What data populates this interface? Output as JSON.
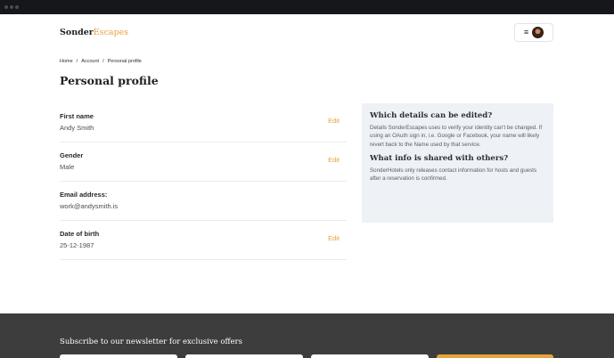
{
  "brand": {
    "name_part1": "Sonder",
    "name_part2": "Escapes"
  },
  "header": {
    "menu_icon": "hamburger-icon",
    "avatar_icon": "user-avatar"
  },
  "breadcrumb": [
    "Home",
    "Account",
    "Personal profile"
  ],
  "page": {
    "title": "Personal profile"
  },
  "fields": [
    {
      "label": "First name",
      "value": "Andy Smith",
      "edit": "Edit"
    },
    {
      "label": "Gender",
      "value": "Male",
      "edit": "Edit"
    },
    {
      "label": "Email address:",
      "value": "work@andysmith.is"
    },
    {
      "label": "Date of birth",
      "value": "25-12-1987",
      "edit": "Edit"
    }
  ],
  "info": {
    "heading1": "Which details can be edited?",
    "text1": "Details SonderEscapes uses to verify your identity can't be changed. If using an OAuth sign in, i.e. Google or Facebook, your name will likely revert back to the Name used by that service.",
    "heading2": "What info is shared with others?",
    "text2": "SonderHotels only releases contact information for hosts and guests after a reservation is confirmed."
  },
  "footer": {
    "newsletter_title": "Subscribe to our newsletter for exclusive offers"
  },
  "colors": {
    "accent": "#e6a33b",
    "footer_bg": "#3d3d3d",
    "panel_bg": "#eef1f5"
  }
}
